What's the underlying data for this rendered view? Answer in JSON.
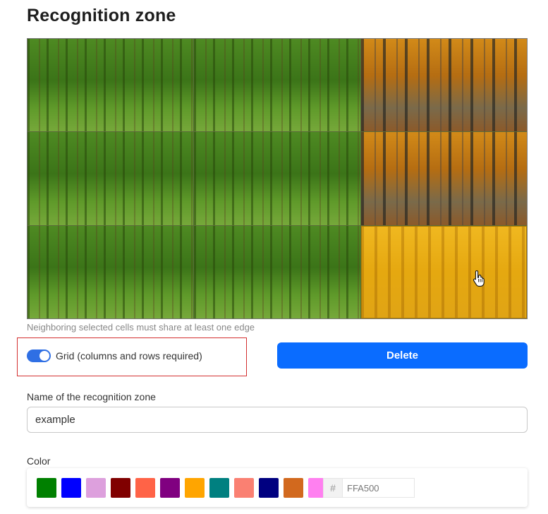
{
  "title": "Recognition zone",
  "hint": "Neighboring selected cells must share at least one edge",
  "grid_toggle": {
    "label": "Grid (columns and rows required)",
    "enabled": true
  },
  "delete_label": "Delete",
  "name_field": {
    "label": "Name of the recognition zone",
    "value": "example"
  },
  "color_field": {
    "label": "Color",
    "swatches": [
      "#008000",
      "#0000FF",
      "#DDA0DD",
      "#800000",
      "#FF6347",
      "#800080",
      "#FFA500",
      "#008080",
      "#FA8072",
      "#000080",
      "#D2691E",
      "#FF80F0"
    ],
    "hex_prefix": "#",
    "hex_value": "FFA500"
  },
  "zone_grid": {
    "columns": 3,
    "rows": 3,
    "cells": [
      "green",
      "green",
      "autumn",
      "green",
      "green",
      "autumn",
      "green",
      "green",
      "selected"
    ]
  },
  "icons": {
    "cursor": "hand-pointer-icon"
  }
}
